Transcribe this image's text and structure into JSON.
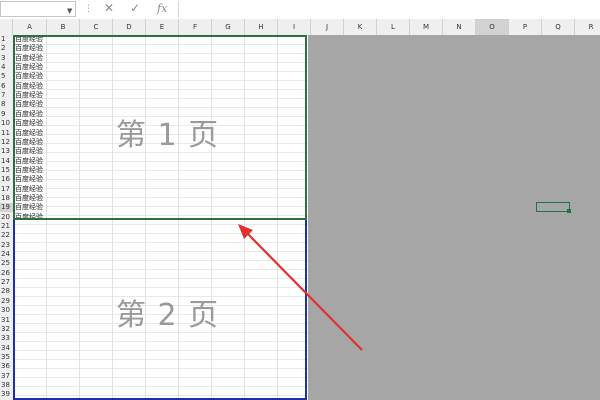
{
  "formula_bar": {
    "fx_label": "fx",
    "cancel_glyph": "✕",
    "enter_glyph": "✓",
    "separator": "⋮"
  },
  "columns": [
    "A",
    "B",
    "C",
    "D",
    "E",
    "F",
    "G",
    "H",
    "I",
    "J",
    "K",
    "L",
    "M",
    "N",
    "O",
    "P",
    "Q",
    "R"
  ],
  "rows": [
    "1",
    "2",
    "3",
    "4",
    "5",
    "6",
    "7",
    "8",
    "9",
    "10",
    "11",
    "12",
    "13",
    "14",
    "15",
    "16",
    "17",
    "18",
    "19",
    "20",
    "21",
    "22",
    "23",
    "24",
    "25",
    "26",
    "27",
    "28",
    "29",
    "30",
    "31",
    "32",
    "33",
    "34",
    "35",
    "36",
    "37",
    "38",
    "39"
  ],
  "cell_text": "百度经验",
  "page_labels": {
    "page1": "第 1 页",
    "page2": "第 2 页"
  },
  "selected_column": "O",
  "selected_row": "19",
  "colors": {
    "page1_border": "#2f6f3f",
    "page2_border": "#1e2fa8",
    "arrow": "#e03030",
    "gray_area": "#a6a6a6"
  },
  "icons": [
    "cancel-icon",
    "enter-icon",
    "function-icon",
    "dropdown-arrow-icon"
  ]
}
